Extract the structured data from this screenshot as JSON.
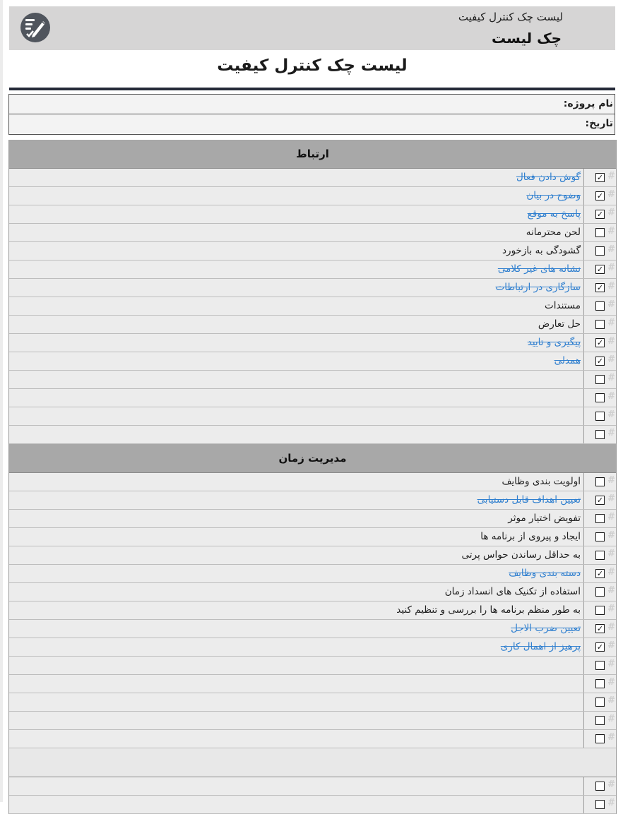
{
  "header": {
    "subtitle": "لیست چک کنترل کیفیت",
    "title": "چک لیست",
    "logo_icon": "checklist-pen-icon"
  },
  "page_title": "لیست چک کنترل کیفیت",
  "info": {
    "project_label": "نام پروژه:",
    "date_label": "تاریخ:"
  },
  "colors": {
    "header_bg": "#d6d5d5",
    "section_bg": "#a8a8a8",
    "row_bg": "#ececec",
    "done_text": "#2f7fcf",
    "logo_bg": "#50555d",
    "rule": "#252a38"
  },
  "sections": [
    {
      "title": "ارتباط",
      "items": [
        {
          "text": "گوش دادن فعال",
          "checked": true
        },
        {
          "text": "وضوح در بیان",
          "checked": true
        },
        {
          "text": "پاسخ به موقع",
          "checked": true
        },
        {
          "text": "لحن محترمانه",
          "checked": false
        },
        {
          "text": "گشودگی به بازخورد",
          "checked": false
        },
        {
          "text": "نشانه های غیر کلامی",
          "checked": true
        },
        {
          "text": "سازگاری در ارتباطات",
          "checked": true
        },
        {
          "text": "مستندات",
          "checked": false
        },
        {
          "text": "حل تعارض",
          "checked": false
        },
        {
          "text": "پیگیری و تایید",
          "checked": true
        },
        {
          "text": "همدلی",
          "checked": true
        },
        {
          "text": "",
          "checked": false
        },
        {
          "text": "",
          "checked": false
        },
        {
          "text": "",
          "checked": false
        },
        {
          "text": "",
          "checked": false
        }
      ]
    },
    {
      "title": "مدیریت زمان",
      "items": [
        {
          "text": "اولویت بندی وظایف",
          "checked": false
        },
        {
          "text": "تعیین اهداف قابل دستیابی",
          "checked": true
        },
        {
          "text": "تفویض اختیار موثر",
          "checked": false
        },
        {
          "text": "ایجاد و پیروی از برنامه ها",
          "checked": false
        },
        {
          "text": "به حداقل رساندن حواس پرتی",
          "checked": false
        },
        {
          "text": "دسته بندی وظایف",
          "checked": true
        },
        {
          "text": "استفاده از تکنیک های انسداد زمان",
          "checked": false
        },
        {
          "text": "به طور منظم برنامه ها را بررسی و تنظیم کنید",
          "checked": false
        },
        {
          "text": "تعیین ضرب الاجل",
          "checked": true
        },
        {
          "text": "پرهیز از اهمال کاری",
          "checked": true
        },
        {
          "text": "",
          "checked": false
        },
        {
          "text": "",
          "checked": false
        },
        {
          "text": "",
          "checked": false
        },
        {
          "text": "",
          "checked": false
        },
        {
          "text": "",
          "checked": false
        }
      ]
    },
    {
      "title": "",
      "items": [
        {
          "text": "",
          "checked": false
        },
        {
          "text": "",
          "checked": false
        }
      ]
    }
  ]
}
